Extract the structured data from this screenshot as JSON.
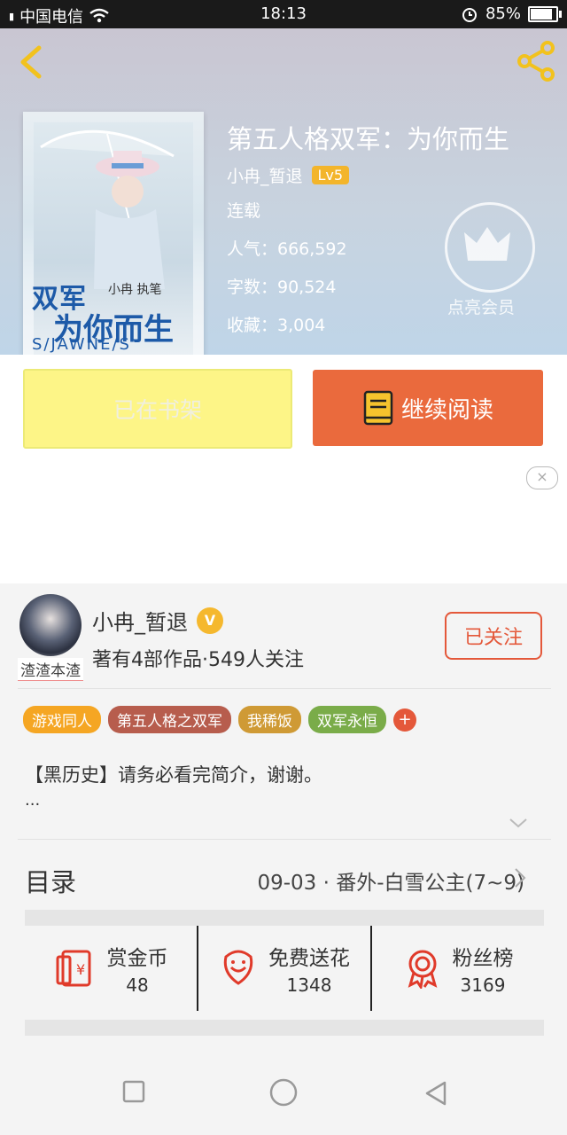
{
  "status_bar": {
    "carrier": "中国电信",
    "network": "4G",
    "time": "18:13",
    "battery": "85%",
    "battery_level": 0.85
  },
  "header": {
    "title": "第五人格双军：为你而生",
    "author": "小冉_暂退",
    "level": "Lv5",
    "state": "连载",
    "popularity": "人气：666,592",
    "word_count": "字数：90,524",
    "favorites": "收藏：3,004",
    "vip_label": "点亮会员"
  },
  "cover": {
    "title_line1": "双军",
    "title_line2": "为你而生",
    "byline": "小冉 执笔",
    "subtitle": "S/JAWNE/S"
  },
  "actions": {
    "shelf_label": "已在书架",
    "read_label": "继续阅读"
  },
  "ad": {
    "close": "×"
  },
  "author_card": {
    "avatar_tag": "渣渣本渣",
    "name": "小冉_暂退",
    "badge": "V",
    "stats": "著有4部作品·549人关注",
    "follow_label": "已关注"
  },
  "tags": [
    {
      "label": "游戏同人",
      "color": "#f5a623"
    },
    {
      "label": "第五人格之双军",
      "color": "#b75d4d"
    },
    {
      "label": "我稀饭",
      "color": "#cf9a35"
    },
    {
      "label": "双军永恒",
      "color": "#7aac49"
    }
  ],
  "intro": {
    "text": "【黑历史】请务必看完简介，谢谢。",
    "more": "..."
  },
  "toc": {
    "label": "目录",
    "latest": "09-03 · 番外-白雪公主(7~9)"
  },
  "rewards": [
    {
      "label": "赏金币",
      "value": "48",
      "icon": "red-envelope-icon"
    },
    {
      "label": "免费送花",
      "value": "1348",
      "icon": "flower-icon"
    },
    {
      "label": "粉丝榜",
      "value": "3169",
      "icon": "medal-icon"
    }
  ],
  "accent": "#ea6a3d"
}
